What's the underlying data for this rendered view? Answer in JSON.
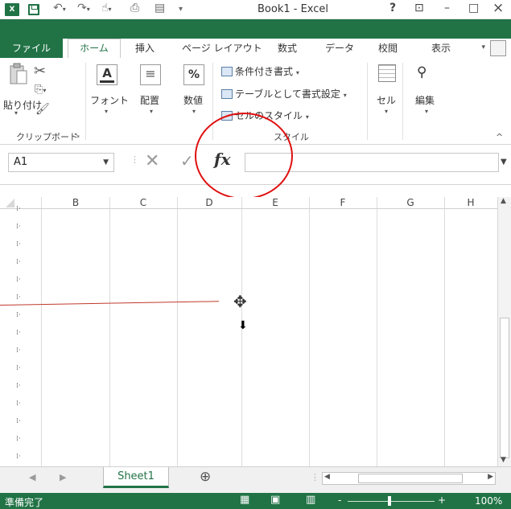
{
  "app": {
    "title": "Book1 - Excel",
    "logo_text": "X"
  },
  "window": {
    "help": "?",
    "ribbon_display": "⊡",
    "minimize": "–",
    "maximize": "□",
    "close": "×"
  },
  "tabs": {
    "file": "ファイル",
    "home": "ホーム",
    "insert": "挿入",
    "page_layout": "ページ レイアウト",
    "formulas": "数式",
    "data": "データ",
    "review": "校閲",
    "view": "表示"
  },
  "ribbon": {
    "clipboard": {
      "paste": "貼り付け",
      "label": "クリップボード"
    },
    "font": {
      "label": "フォント"
    },
    "alignment": {
      "label": "配置"
    },
    "number": {
      "label": "数値",
      "symbol": "%"
    },
    "styles": {
      "conditional": "条件付き書式",
      "table": "テーブルとして書式設定",
      "cell_styles": "セルのスタイル",
      "label": "スタイル"
    },
    "cells": {
      "label": "セル"
    },
    "editing": {
      "label": "編集"
    }
  },
  "formula_bar": {
    "name_box": "A1",
    "fx": "fx"
  },
  "columns": [
    "B",
    "C",
    "D",
    "E",
    "F",
    "G",
    "H"
  ],
  "sheet": {
    "tab_name": "Sheet1",
    "add": "⊕"
  },
  "status": {
    "ready": "準備完了",
    "zoom": "100%",
    "minus": "-",
    "plus": "+"
  },
  "colors": {
    "accent": "#217346",
    "annotation": "#e01010"
  }
}
